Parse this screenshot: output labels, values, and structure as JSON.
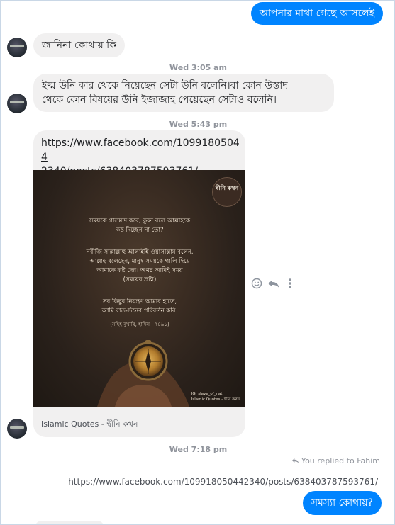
{
  "messages": {
    "out_1": "আপনার মাথা গেছে আসলেই",
    "in_1": "জানিনা কোথায় কি",
    "ts_1": "Wed 3:05 am",
    "in_2_line1": "ইল্ম উনি কার থেকে নিয়েছেন সেটা উনি বলেনি।বা কোন উস্তাদ",
    "in_2_line2": "থেকে কোন বিষয়ের উনি ইজাজাহ পেয়েছেন সেটাও বলেনি।",
    "ts_2": "Wed 5:43 pm",
    "shared_link_line1": "https://www.facebook.com/10991805044",
    "shared_link_line2": "2340/posts/638403787593761/",
    "ts_3": "Wed 7:18 pm",
    "reply_note": "You replied to Fahim",
    "quoted_link": "https://www.facebook.com/109918050442340/posts/638403787593761/",
    "out_2": "সমস্যা কোথায়?"
  },
  "post": {
    "logo_text": "দ্বীনি কথন",
    "text_1a": "সময়কে গালমন্দ করে, কুফা বলে আল্লাহকে",
    "text_1b": "কষ্ট দিচ্ছেন না তো?",
    "text_2a": "নবীজি সাল্লাল্লাহু আলাইহি ওয়াসাল্লাম বলেন,",
    "text_2b": "আল্লাহ বলেছেন, মানুষ সময়কে গালি দিয়ে",
    "text_2c": "আমাকে কষ্ট দেয়। অথচ আমিই সময়",
    "text_2d": "(সময়ের স্রষ্টা)",
    "text_3a": "সব কিছুর নিয়ন্ত্রণ আমার হাতে,",
    "text_3b": "আমি রাত-দিনের পরিবর্তন করি।",
    "source": "(সহিহ বুখারি, হাদিস : ৭৪৯১)",
    "credit_1": "IG: slave_of_nat",
    "credit_2": "Islamic Quotes - দ্বীনি কথন",
    "caption": "Islamic Quotes - দ্বীনি কথন"
  },
  "icons": {
    "react": "emoji-smile-icon",
    "reply": "reply-arrow-icon",
    "more": "more-vertical-icon",
    "reply_note": "reply-arrow-icon"
  },
  "colors": {
    "outgoing": "#0084ff",
    "incoming": "#f1f0f0",
    "timestamp": "#90949c"
  }
}
